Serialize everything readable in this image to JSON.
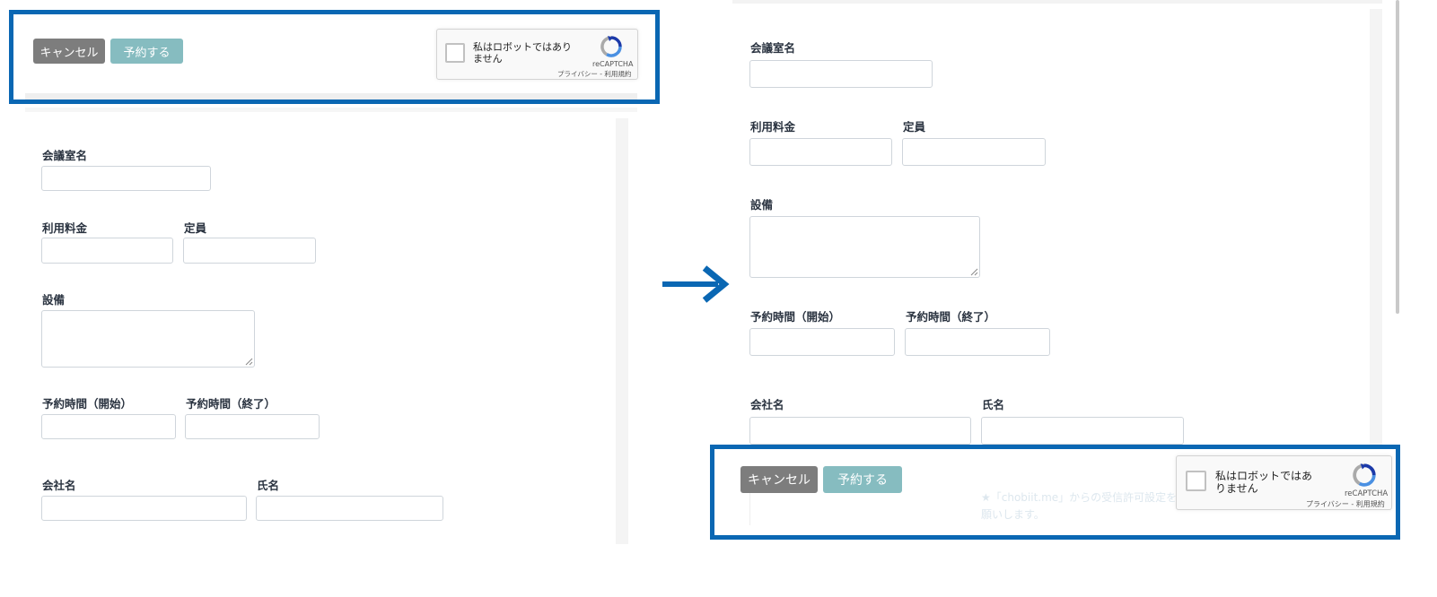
{
  "colors": {
    "highlight": "#0a67b3",
    "arrow": "#0a67b3",
    "cancel_button": "#7d7d7d",
    "submit_button": "#86bcc0"
  },
  "icons": {
    "arrow": "arrow-right-icon",
    "recaptcha": "recaptcha-logo-icon"
  },
  "before": {
    "toolbar": {
      "cancel_label": "キャンセル",
      "submit_label": "予約する"
    },
    "captcha": {
      "text": "私はロボットではありません",
      "brand": "reCAPTCHA",
      "privacy": "プライバシー - 利用規約"
    },
    "form": {
      "room_name_label": "会議室名",
      "fee_label": "利用料金",
      "capacity_label": "定員",
      "equipment_label": "設備",
      "start_label": "予約時間（開始）",
      "end_label": "予約時間（終了）",
      "company_label": "会社名",
      "name_label": "氏名"
    }
  },
  "after": {
    "form": {
      "room_name_label": "会議室名",
      "fee_label": "利用料金",
      "capacity_label": "定員",
      "equipment_label": "設備",
      "start_label": "予約時間（開始）",
      "end_label": "予約時間（終了）",
      "company_label": "会社名",
      "name_label": "氏名"
    },
    "toolbar": {
      "cancel_label": "キャンセル",
      "submit_label": "予約する"
    },
    "captcha": {
      "text": "私はロボットではありません",
      "brand": "reCAPTCHA",
      "privacy": "プライバシー - 利用規約"
    },
    "notice": "★「chobiit.me」からの受信許可設定をお願いします。"
  }
}
